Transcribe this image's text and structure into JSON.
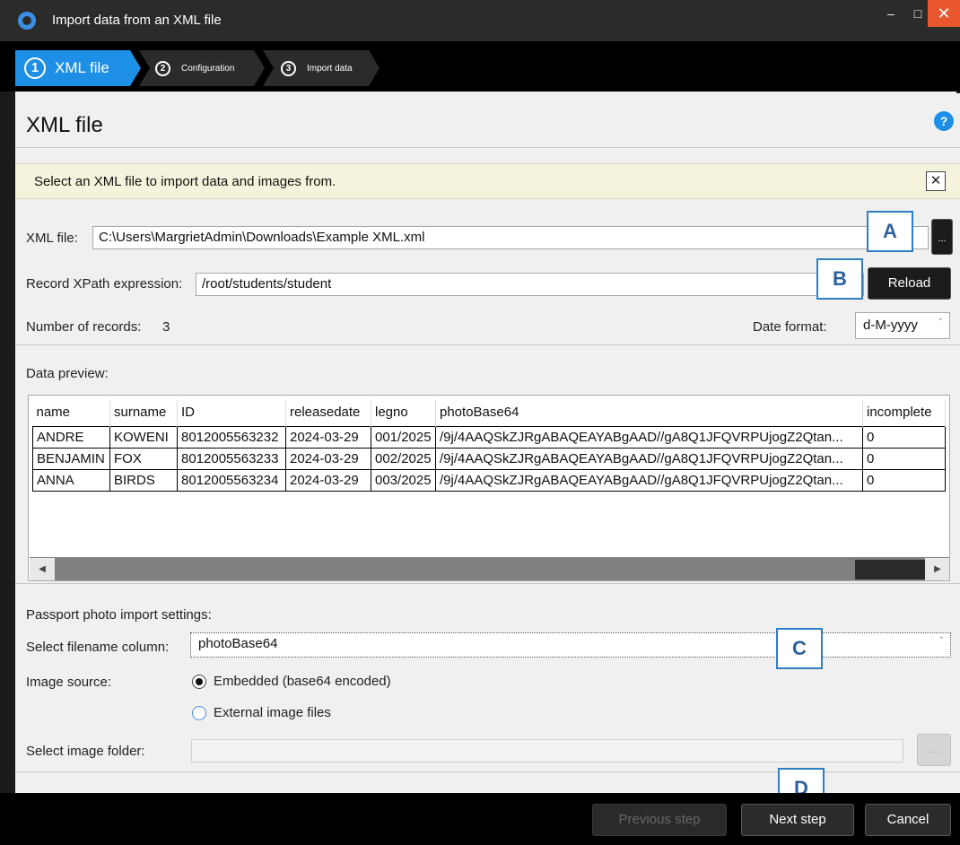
{
  "window": {
    "title": "Import data from an XML file",
    "controls": {
      "minimize": "–",
      "maximize": "□",
      "close": "✕"
    }
  },
  "steps": [
    {
      "number": "1",
      "label": "XML file",
      "active": true
    },
    {
      "number": "2",
      "label": "Configuration",
      "active": false
    },
    {
      "number": "3",
      "label": "Import data",
      "active": false
    }
  ],
  "page": {
    "title": "XML file",
    "help": "?"
  },
  "banner": {
    "text": "Select an XML file to import data and images from.",
    "close": "✕"
  },
  "xml_file": {
    "label": "XML file:",
    "value": "C:\\Users\\MargrietAdmin\\Downloads\\Example XML.xml",
    "browse_label": "..."
  },
  "xpath": {
    "label": "Record XPath expression:",
    "value": "/root/students/student",
    "reload_label": "Reload"
  },
  "records": {
    "label": "Number of records:",
    "count": "3"
  },
  "date_format": {
    "label": "Date format:",
    "value": "d-M-yyyy"
  },
  "preview": {
    "label": "Data preview:",
    "columns": [
      "name",
      "surname",
      "ID",
      "releasedate",
      "legno",
      "photoBase64",
      "incomplete"
    ],
    "rows": [
      [
        "ANDRE",
        "KOWENI",
        "8012005563232",
        "2024-03-29",
        "001/2025",
        "/9j/4AAQSkZJRgABAQEAYABgAAD//gA8Q1JFQVRPUjogZ2Qtan...",
        "0"
      ],
      [
        "BENJAMIN",
        "FOX",
        "8012005563233",
        "2024-03-29",
        "002/2025",
        "/9j/4AAQSkZJRgABAQEAYABgAAD//gA8Q1JFQVRPUjogZ2Qtan...",
        "0"
      ],
      [
        "ANNA",
        "BIRDS",
        "8012005563234",
        "2024-03-29",
        "003/2025",
        "/9j/4AAQSkZJRgABAQEAYABgAAD//gA8Q1JFQVRPUjogZ2Qtan...",
        "0"
      ]
    ],
    "scroll_left": "◀",
    "scroll_right": "▶"
  },
  "photo_settings": {
    "heading": "Passport photo import settings:",
    "filename_label": "Select filename column:",
    "filename_value": "photoBase64",
    "source_label": "Image source:",
    "options": [
      {
        "label": "Embedded (base64 encoded)",
        "selected": true
      },
      {
        "label": "External image files",
        "selected": false
      }
    ],
    "folder_label": "Select image folder:",
    "folder_value": "",
    "folder_browse": "..."
  },
  "callouts": {
    "a": "A",
    "b": "B",
    "c": "C",
    "d": "D"
  },
  "footer": {
    "previous": "Previous step",
    "next": "Next step",
    "cancel": "Cancel"
  },
  "colors": {
    "accent": "#1e8fe6",
    "banner": "#f5f3dc",
    "callout_border": "#2e7fc2",
    "close_button": "#e8572d"
  }
}
